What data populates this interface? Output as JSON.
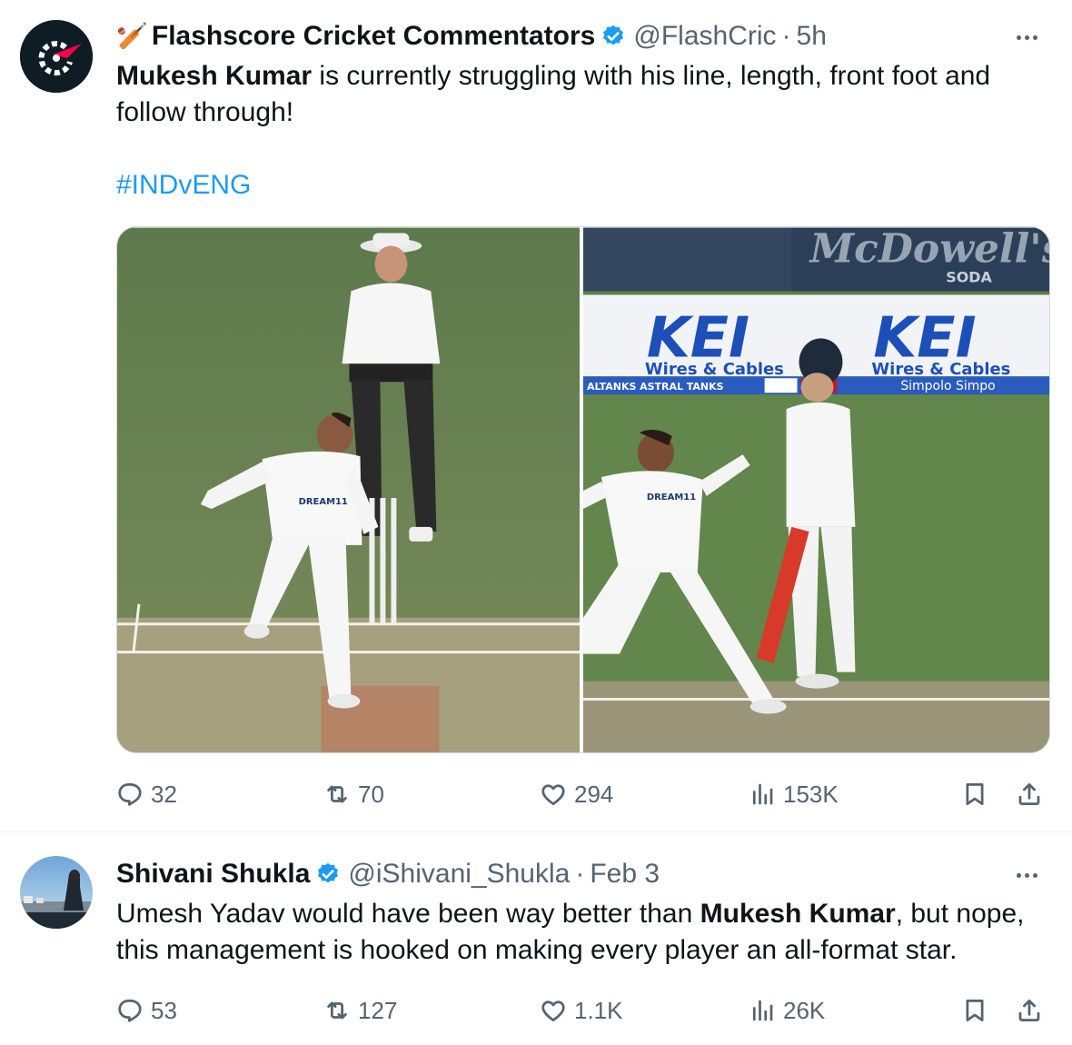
{
  "tweet1": {
    "author_emoji": "🏏",
    "author": "Flashscore Cricket Commentators",
    "handle": "@FlashCric",
    "sep": "·",
    "time": "5h",
    "text_bold": "Mukesh Kumar",
    "text_rest_1": " is currently struggling with his line, length, front foot and",
    "text_rest_2": "follow through!",
    "hashtag": "#INDvENG",
    "images": {
      "left_alt": "Bowler in delivery stride with umpire behind",
      "right_ad_1": "KEI",
      "right_ad_2": "Wires & Cables",
      "right_board_1": "ASTRAL TANKS",
      "right_board_2": "Simpolo",
      "right_top_1": "McDowell's",
      "right_top_2": "SODA"
    },
    "replies": "32",
    "reposts": "70",
    "likes": "294",
    "views": "153K"
  },
  "tweet2": {
    "author": "Shivani Shukla",
    "handle": "@iShivani_Shukla",
    "sep": "·",
    "time": "Feb 3",
    "text_1a": "Umesh Yadav would have been way better than ",
    "text_bold": "Mukesh Kumar",
    "text_1b": ", but nope,",
    "text_2": "this management is hooked on making every player an all-format star.",
    "replies": "53",
    "reposts": "127",
    "likes": "1.1K",
    "views": "26K"
  },
  "colors": {
    "accent": "#1d9bf0",
    "muted": "#536471",
    "verified": "#1d9bf0"
  },
  "icons": [
    "reply-icon",
    "repost-icon",
    "like-icon",
    "views-icon",
    "bookmark-icon",
    "share-icon",
    "more-icon",
    "verified-icon"
  ]
}
